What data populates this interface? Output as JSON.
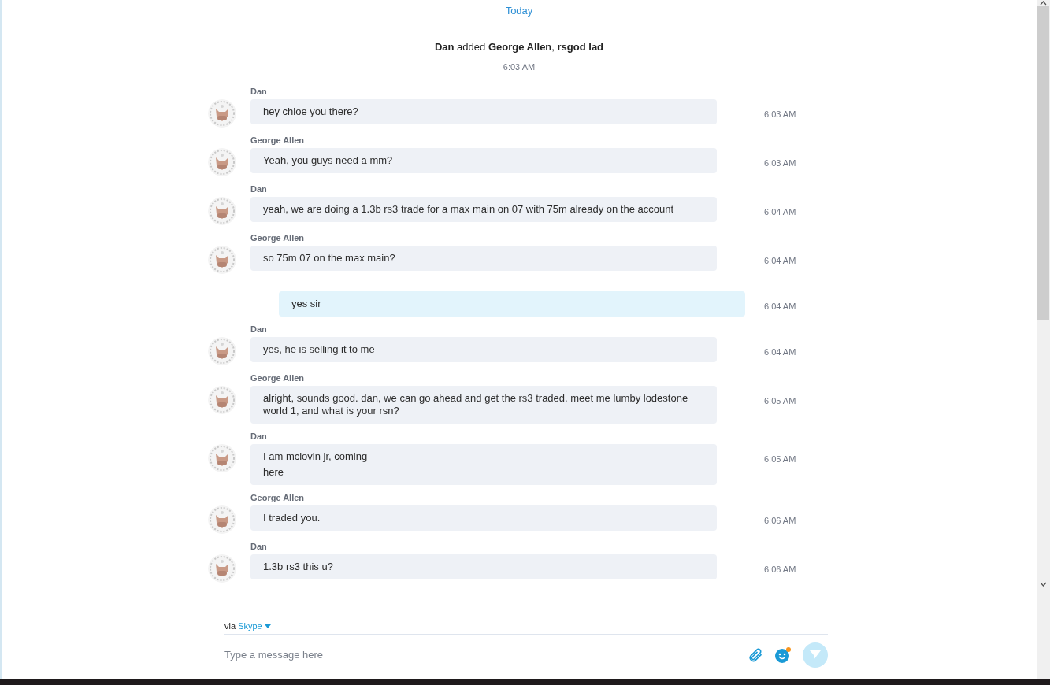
{
  "day_label": "Today",
  "system_event": {
    "text": "**Dan** added **George Allen**, **rsgod lad**",
    "time": "6:03 AM"
  },
  "messages": [
    {
      "kind": "incoming",
      "sender": "Dan",
      "lines": [
        "hey chloe you there?"
      ],
      "time": "6:03 AM"
    },
    {
      "kind": "incoming",
      "sender": "George Allen",
      "lines": [
        "Yeah, you guys need a mm?"
      ],
      "time": "6:03 AM"
    },
    {
      "kind": "incoming",
      "sender": "Dan",
      "lines": [
        "yeah, we are doing a 1.3b rs3 trade for a max main on 07 with 75m already on the account"
      ],
      "time": "6:04 AM"
    },
    {
      "kind": "incoming",
      "sender": "George Allen",
      "lines": [
        "so 75m 07 on the max main?"
      ],
      "time": "6:04 AM"
    },
    {
      "kind": "outgoing",
      "lines": [
        "yes sir"
      ],
      "time": "6:04 AM"
    },
    {
      "kind": "incoming",
      "sender": "Dan",
      "lines": [
        "yes, he is selling it to me"
      ],
      "time": "6:04 AM"
    },
    {
      "kind": "incoming",
      "sender": "George Allen",
      "lines": [
        "alright, sounds good. dan, we can go ahead and get the rs3 traded. meet me lumby lodestone world 1, and what is your rsn?"
      ],
      "time": "6:05 AM"
    },
    {
      "kind": "incoming",
      "sender": "Dan",
      "lines": [
        "I am mclovin jr, coming",
        "here"
      ],
      "time": "6:05 AM"
    },
    {
      "kind": "incoming",
      "sender": "George Allen",
      "lines": [
        "I traded you."
      ],
      "time": "6:06 AM"
    },
    {
      "kind": "incoming",
      "sender": "Dan",
      "lines": [
        "1.3b rs3 this u?"
      ],
      "time": "6:06 AM"
    }
  ],
  "composer": {
    "via_label": "via",
    "service": "Skype",
    "placeholder": "Type a message here",
    "emoji_notification": true
  }
}
